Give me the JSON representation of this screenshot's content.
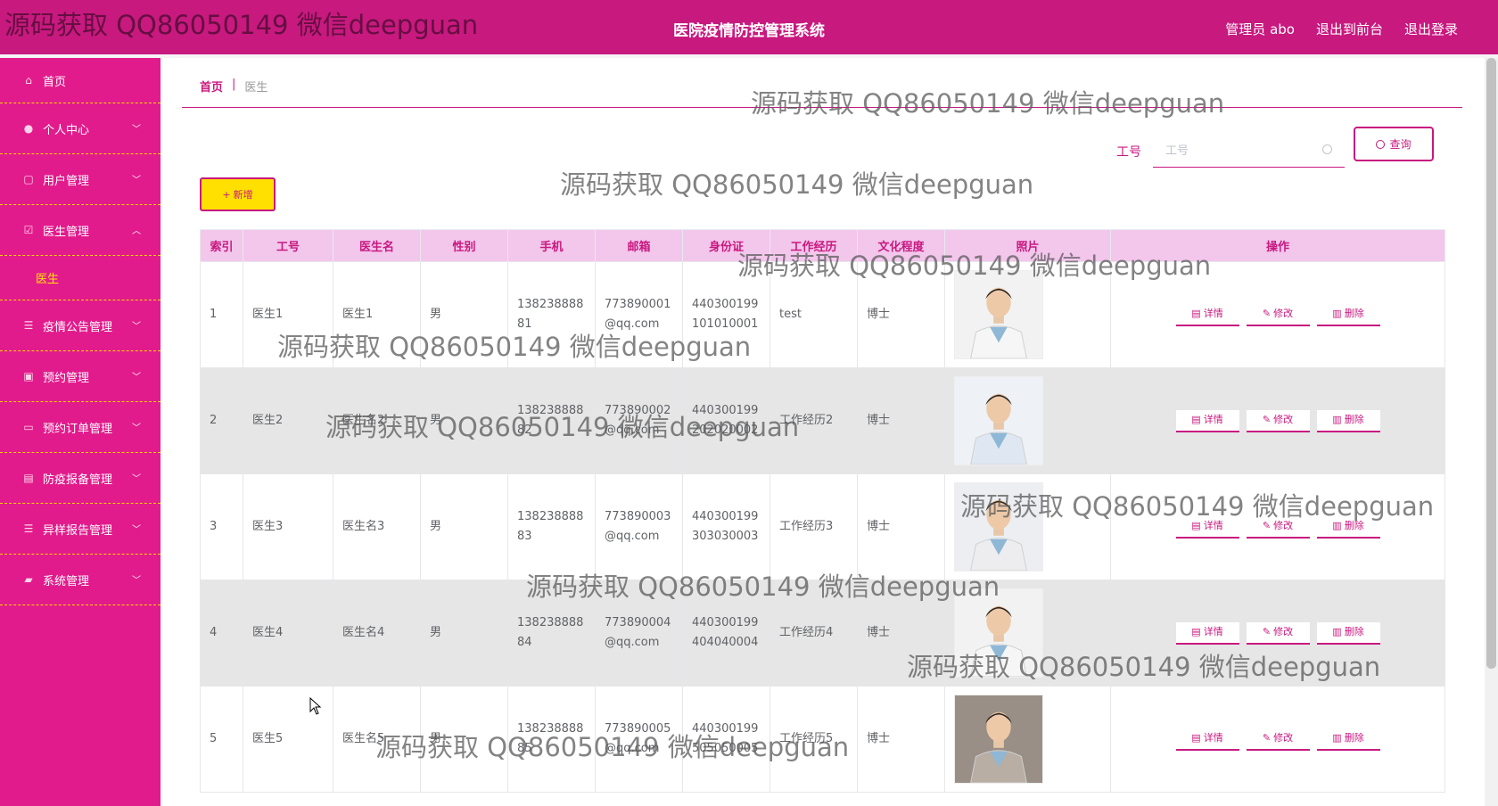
{
  "header": {
    "title": "医院疫情防控管理系统",
    "links": [
      {
        "label": "管理员 abo"
      },
      {
        "label": "退出到前台"
      },
      {
        "label": "退出登录"
      }
    ]
  },
  "sidebar": {
    "items": [
      {
        "label": "首页",
        "icon": "home-icon",
        "expandable": false
      },
      {
        "label": "个人中心",
        "icon": "user-icon",
        "expandable": true
      },
      {
        "label": "用户管理",
        "icon": "copy-icon",
        "expandable": true
      },
      {
        "label": "医生管理",
        "icon": "checkbox-icon",
        "expandable": true,
        "expanded": true,
        "children": [
          "医生"
        ]
      },
      {
        "label": "疫情公告管理",
        "icon": "list-icon",
        "expandable": true
      },
      {
        "label": "预约管理",
        "icon": "clipboard-icon",
        "expandable": true
      },
      {
        "label": "预约订单管理",
        "icon": "message-icon",
        "expandable": true
      },
      {
        "label": "防疫报备管理",
        "icon": "document-icon",
        "expandable": true
      },
      {
        "label": "异样报告管理",
        "icon": "list-icon",
        "expandable": true
      },
      {
        "label": "系统管理",
        "icon": "thumb-icon",
        "expandable": true
      }
    ]
  },
  "breadcrumb": {
    "home": "首页",
    "separator": "|",
    "current": "医生"
  },
  "search": {
    "label": "工号",
    "placeholder": "工号",
    "button_label": "查询"
  },
  "toolbar": {
    "add_label": "新增"
  },
  "table": {
    "columns": [
      "索引",
      "工号",
      "医生名",
      "性别",
      "手机",
      "邮箱",
      "身份证",
      "工作经历",
      "文化程度",
      "照片",
      "操作"
    ],
    "actions": {
      "detail": "详情",
      "edit": "修改",
      "delete": "删除"
    },
    "rows": [
      {
        "index": "1",
        "id": "医生1",
        "name": "医生1",
        "gender": "男",
        "phone": "13823888881",
        "email": "773890001@qq.com",
        "idcard": "440300199101010001",
        "experience": "test",
        "education": "博士"
      },
      {
        "index": "2",
        "id": "医生2",
        "name": "医生名2",
        "gender": "男",
        "phone": "13823888882",
        "email": "773890002@qq.com",
        "idcard": "440300199202020002",
        "experience": "工作经历2",
        "education": "博士"
      },
      {
        "index": "3",
        "id": "医生3",
        "name": "医生名3",
        "gender": "男",
        "phone": "13823888883",
        "email": "773890003@qq.com",
        "idcard": "440300199303030003",
        "experience": "工作经历3",
        "education": "博士"
      },
      {
        "index": "4",
        "id": "医生4",
        "name": "医生名4",
        "gender": "男",
        "phone": "13823888884",
        "email": "773890004@qq.com",
        "idcard": "440300199404040004",
        "experience": "工作经历4",
        "education": "博士"
      },
      {
        "index": "5",
        "id": "医生5",
        "name": "医生名5",
        "gender": "男",
        "phone": "13823888885",
        "email": "773890005@qq.com",
        "idcard": "440300199505050005",
        "experience": "工作经历5",
        "education": "博士"
      }
    ]
  },
  "watermark": {
    "text": "源码获取 QQ86050149 微信deepguan"
  },
  "colors": {
    "primary": "#c8197f",
    "sidebar": "#e21b8c",
    "accent": "#ffe000",
    "header_row": "#f3c6ec"
  }
}
